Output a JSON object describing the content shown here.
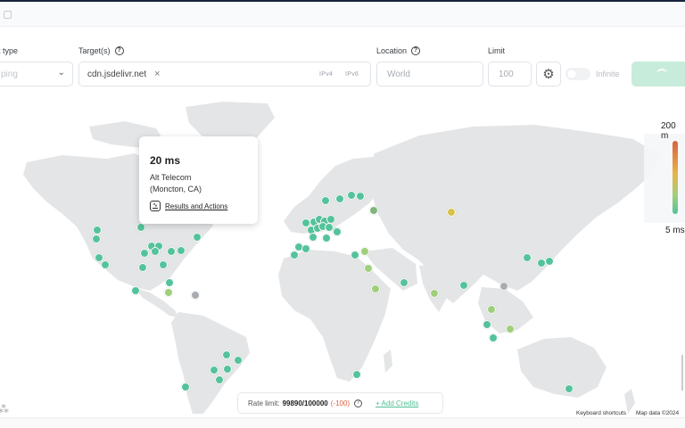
{
  "header": {
    "type_label": "t type",
    "type_value": "ping",
    "targets_label": "Target(s)",
    "target_tag": "cdn.jsdelivr.net",
    "ipv4": "IPv4",
    "ipv6": "IPv6",
    "location_label": "Location",
    "location_placeholder": "World",
    "limit_label": "Limit",
    "limit_placeholder": "100",
    "infinite_label": "Infinite"
  },
  "tooltip": {
    "latency": "20 ms",
    "isp": "Alt Telecom",
    "location": "(Moncton, CA)",
    "link": "Results and Actions"
  },
  "legend": {
    "max": "200 m",
    "min": "5 ms",
    "colors": [
      "#d9603f",
      "#e8b54a",
      "#9fcf7b",
      "#54c39b"
    ]
  },
  "rate_limit": {
    "label": "Rate limit:",
    "value": "99890/100000",
    "delta": "(-100)",
    "add_credits": "+ Add Credits"
  },
  "footer": {
    "keyboard_shortcuts": "Keyboard shortcuts",
    "map_data": "Map data ©2024"
  },
  "colors": {
    "green": "#54c39b",
    "lime": "#9fcf7b",
    "yellow": "#d8c04a",
    "gray": "#a8acb1"
  }
}
